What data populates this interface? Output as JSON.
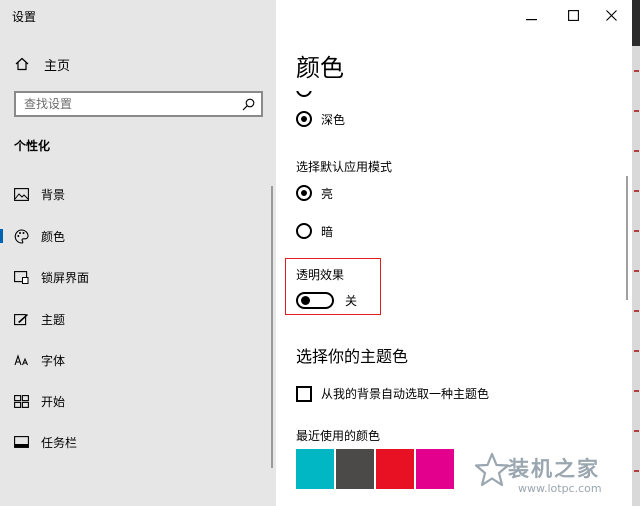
{
  "app": {
    "title": "设置"
  },
  "sidebar": {
    "home_label": "主页",
    "search_placeholder": "查找设置",
    "section_title": "个性化",
    "items": [
      {
        "label": "背景",
        "icon": "picture-icon"
      },
      {
        "label": "颜色",
        "icon": "palette-icon",
        "active": true
      },
      {
        "label": "锁屏界面",
        "icon": "lockscreen-icon"
      },
      {
        "label": "主题",
        "icon": "theme-icon"
      },
      {
        "label": "字体",
        "icon": "font-icon"
      },
      {
        "label": "开始",
        "icon": "start-icon"
      },
      {
        "label": "任务栏",
        "icon": "taskbar-icon"
      }
    ]
  },
  "window": {
    "minimize": "—",
    "maximize": "☐",
    "close": "✕"
  },
  "main": {
    "title": "颜色",
    "mode_options": [
      {
        "label": "深色",
        "selected": true
      }
    ],
    "app_mode_label": "选择默认应用模式",
    "app_mode_options": [
      {
        "label": "亮",
        "selected": true
      },
      {
        "label": "暗",
        "selected": false
      }
    ],
    "transparency_label": "透明效果",
    "transparency_state": "关",
    "accent_title": "选择你的主题色",
    "auto_pick_label": "从我的背景自动选取一种主题色",
    "recent_colors_label": "最近使用的颜色",
    "recent_colors": [
      "#00b7c3",
      "#4c4a48",
      "#e81123",
      "#e3008c"
    ]
  },
  "watermark": {
    "text": "装机之家",
    "url": "www.lotpc.com"
  },
  "colors": {
    "accent": "#0063b1",
    "highlight_box": "#e02020",
    "sidebar_bg": "#e6e6e6"
  }
}
